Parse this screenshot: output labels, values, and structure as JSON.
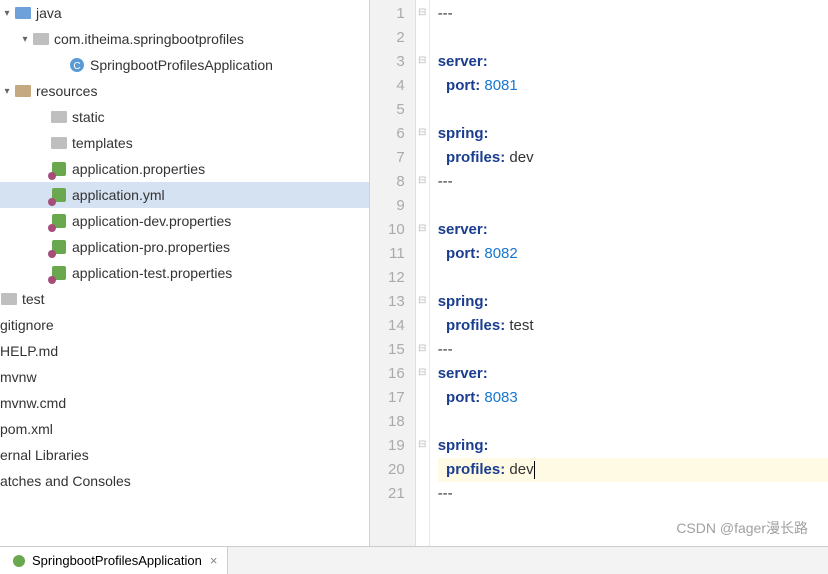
{
  "tree": {
    "java": "java",
    "pkg": "com.itheima.springbootprofiles",
    "app_class": "SpringbootProfilesApplication",
    "resources": "resources",
    "static": "static",
    "templates": "templates",
    "app_props": "application.properties",
    "app_yml": "application.yml",
    "app_dev": "application-dev.properties",
    "app_pro": "application-pro.properties",
    "app_test": "application-test.properties",
    "test": "test",
    "gitignore": "gitignore",
    "help": "HELP.md",
    "mvnw": "mvnw",
    "mvnwcmd": "mvnw.cmd",
    "pom": "pom.xml",
    "ext_lib": "ernal Libraries",
    "scratches": "atches and Consoles"
  },
  "editor": {
    "l1": "---",
    "l2": "",
    "l3a": "server",
    "l4a": "port",
    "l4b": "8081",
    "l5": "",
    "l6a": "spring",
    "l7a": "profiles",
    "l7b": "dev",
    "l8": "---",
    "l9": "",
    "l10a": "server",
    "l11a": "port",
    "l11b": "8082",
    "l12": "",
    "l13a": "spring",
    "l14a": "profiles",
    "l14b": "test",
    "l15": "---",
    "l16a": "server",
    "l17a": "port",
    "l17b": "8083",
    "l18": "",
    "l19a": "spring",
    "l20a": "profiles",
    "l20b": "dev",
    "l21": "---"
  },
  "tab": {
    "label": "SpringbootProfilesApplication",
    "close": "×"
  },
  "watermark": "CSDN @fager漫长路"
}
